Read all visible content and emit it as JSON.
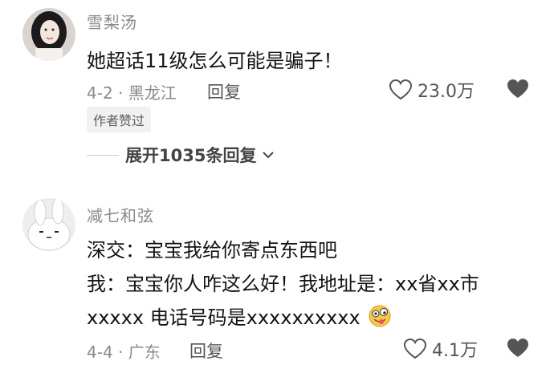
{
  "comments": [
    {
      "username": "雪梨汤",
      "lines": [
        "她超话11级怎么可能是骗子！"
      ],
      "meta": "4-2 · 黑龙江",
      "reply_label": "回复",
      "likes": "23.0万",
      "badge": "作者赞过",
      "expand_label": "展开1035条回复"
    },
    {
      "username": "减七和弦",
      "lines": [
        "深交：宝宝我给你寄点东西吧",
        "我：宝宝你人咋这么好！我地址是：xx省xx市",
        "xxxxx 电话号码是xxxxxxxxxx"
      ],
      "meta": "4-4 · 广东",
      "reply_label": "回复",
      "likes": "4.1万"
    }
  ]
}
